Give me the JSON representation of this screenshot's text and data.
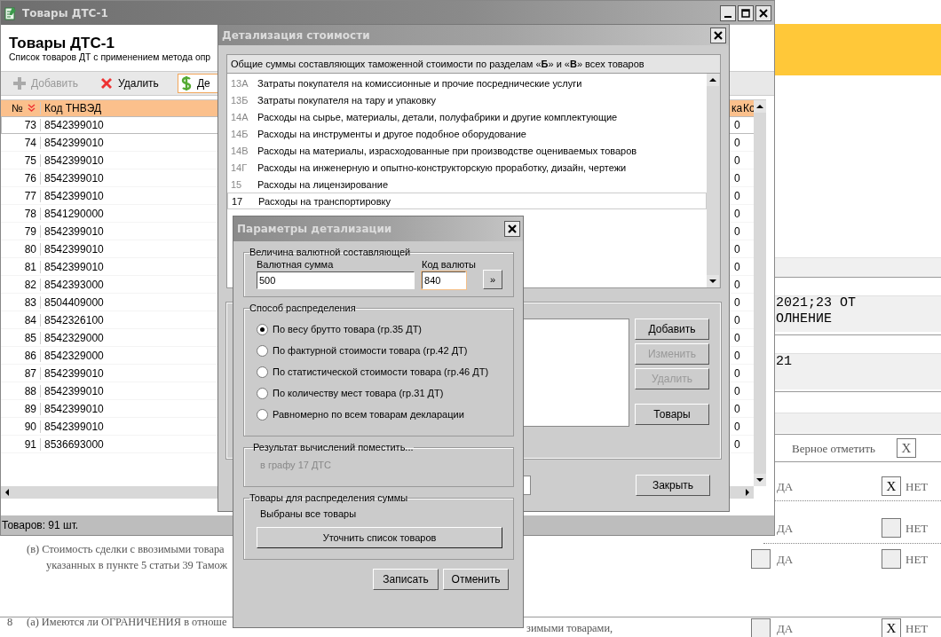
{
  "background_document": {
    "reference_lines": [
      "2021;23 ОТ",
      "ОЛНЕНИЕ",
      "21"
    ],
    "mark_hint": "Верное отметить",
    "mark_hint_box": "X",
    "answer_rows": [
      {
        "kind": "no_only",
        "yes_label": "ДА",
        "no_label": "НЕТ",
        "no_checked": true,
        "mark": "X"
      },
      {
        "kind": "no_only",
        "yes_label": "ДА",
        "no_label": "НЕТ",
        "no_checked": false
      },
      {
        "kind": "both",
        "yes_label": "ДА",
        "no_label": "НЕТ",
        "yes_checked": false,
        "no_checked": false
      },
      {
        "kind": "both",
        "yes_label": "ДА",
        "no_label": "НЕТ",
        "yes_checked": false,
        "no_checked": true,
        "mark": "X"
      }
    ],
    "paragraphs": [
      {
        "lines": [
          "(в) Стоимость сделки с ввозимыми товара",
          "указанных в пункте 5 статьи 39 Тамож"
        ]
      },
      {
        "number": "8",
        "lines": [
          "(а) Имеются ли ОГРАНИЧЕНИЯ в отноше"
        ],
        "tail": "зимыми товарами,"
      }
    ]
  },
  "main_window": {
    "title": "Товары ДТС-1",
    "heading": "Товары ДТС-1",
    "subtitle": "Список товаров ДТ с применением метода опр",
    "toolbar": [
      {
        "label": "Добавить",
        "disabled": true,
        "selected": false
      },
      {
        "label": "Удалить",
        "disabled": false,
        "selected": false
      },
      {
        "label": "Де",
        "disabled": false,
        "selected": true
      }
    ],
    "columns": [
      "№",
      "Код ТНВЭД",
      "ка",
      "Ко"
    ],
    "rows": [
      {
        "num": "73",
        "code": "8542399010",
        "tail": "0",
        "selected": true
      },
      {
        "num": "74",
        "code": "8542399010",
        "tail": "0",
        "selected": false
      },
      {
        "num": "75",
        "code": "8542399010",
        "tail": "0",
        "selected": false
      },
      {
        "num": "76",
        "code": "8542399010",
        "tail": "0",
        "selected": false
      },
      {
        "num": "77",
        "code": "8542399010",
        "tail": "0",
        "selected": false
      },
      {
        "num": "78",
        "code": "8541290000",
        "tail": "0",
        "selected": false
      },
      {
        "num": "79",
        "code": "8542399010",
        "tail": "0",
        "selected": false
      },
      {
        "num": "80",
        "code": "8542399010",
        "tail": "0",
        "selected": false
      },
      {
        "num": "81",
        "code": "8542399010",
        "tail": "0",
        "selected": false
      },
      {
        "num": "82",
        "code": "8542393000",
        "tail": "0",
        "selected": false
      },
      {
        "num": "83",
        "code": "8504409000",
        "tail": "0",
        "selected": false
      },
      {
        "num": "84",
        "code": "8542326100",
        "tail": "0",
        "selected": false
      },
      {
        "num": "85",
        "code": "8542329000",
        "tail": "0",
        "selected": false
      },
      {
        "num": "86",
        "code": "8542329000",
        "tail": "0",
        "selected": false
      },
      {
        "num": "87",
        "code": "8542399010",
        "tail": "0",
        "selected": false
      },
      {
        "num": "88",
        "code": "8542399010",
        "tail": "0",
        "selected": false
      },
      {
        "num": "89",
        "code": "8542399010",
        "tail": "0",
        "selected": false
      },
      {
        "num": "90",
        "code": "8542399010",
        "tail": "0",
        "selected": false
      },
      {
        "num": "91",
        "code": "8536693000",
        "tail": "0",
        "selected": false
      }
    ],
    "status": "Товаров: 91 шт."
  },
  "detail_window": {
    "title": "Детализация стоимости",
    "list_caption": "Общие суммы составляющих таможенной стоимости по разделам «**Б**» и «**В**» всех товаров",
    "items": [
      {
        "code": "13А",
        "text": "Затраты покупателя на комиссионные и прочие посреднические услуги",
        "selected": false
      },
      {
        "code": "13Б",
        "text": "Затраты покупателя на тару и упаковку",
        "selected": false
      },
      {
        "code": "14А",
        "text": "Расходы на сырье, материалы, детали, полуфабрики и другие комплектующие",
        "selected": false
      },
      {
        "code": "14Б",
        "text": "Расходы на инструменты и другое подобное оборудование",
        "selected": false
      },
      {
        "code": "14В",
        "text": "Расходы на материалы, израсходованные при производстве оцениваемых товаров",
        "selected": false
      },
      {
        "code": "14Г",
        "text": "Расходы на инженерную и опытно-конструкторскую проработку, дизайн, чертежи",
        "selected": false
      },
      {
        "code": "15",
        "text": "Расходы на лицензирование",
        "selected": false
      },
      {
        "code": "17",
        "text": "Расходы на транспортировку",
        "selected": true
      }
    ],
    "buttons": [
      {
        "label": "Добавить",
        "disabled": false
      },
      {
        "label": "Изменить",
        "disabled": true
      },
      {
        "label": "Удалить",
        "disabled": true
      },
      {
        "label": "Товары",
        "disabled": false
      }
    ],
    "close_button": "Закрыть"
  },
  "params_dialog": {
    "title": "Параметры детализации",
    "currency_group": "Величина валютной составляющей",
    "amount_label": "Валютная сумма",
    "amount_value": "500",
    "currency_label": "Код валюты",
    "currency_value": "840",
    "picker_button": "»",
    "distribution_group": "Способ распределения",
    "options": [
      {
        "label": "По весу брутто товара (гр.35 ДТ)",
        "selected": true
      },
      {
        "label": "По фактурной стоимости товара (гр.42 ДТ)",
        "selected": false
      },
      {
        "label": "По статистической стоимости товара (гр.46 ДТ)",
        "selected": false
      },
      {
        "label": "По количеству мест товара (гр.31 ДТ)",
        "selected": false
      },
      {
        "label": "Равномерно по всем товарам декларации",
        "selected": false
      }
    ],
    "result_group": "Результат вычислений поместить...",
    "result_text": "в графу 17 ДТС",
    "goods_group": "Товары для распределения суммы",
    "goods_status": "Выбраны все товары",
    "refine_button": "Уточнить список товаров",
    "buttons": [
      "Записать",
      "Отменить"
    ]
  }
}
